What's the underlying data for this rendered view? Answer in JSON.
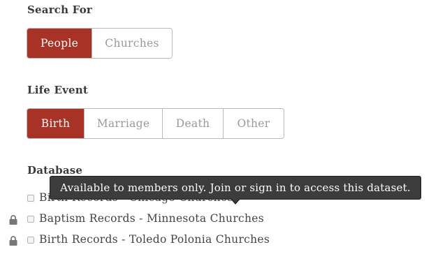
{
  "search_for": {
    "label": "Search For",
    "options": [
      "People",
      "Churches"
    ],
    "selected": "People"
  },
  "life_event": {
    "label": "Life Event",
    "options": [
      "Birth",
      "Marriage",
      "Death",
      "Other"
    ],
    "selected": "Birth"
  },
  "database": {
    "label": "Database",
    "items": [
      {
        "label": "Birth Records - Chicago Churches",
        "locked": false,
        "checked": false
      },
      {
        "label": "Baptism Records - Minnesota Churches",
        "locked": true,
        "checked": false
      },
      {
        "label": "Birth Records - Toledo Polonia Churches",
        "locked": true,
        "checked": false
      }
    ]
  },
  "tooltip": {
    "text": "Available to members only. Join or sign in to access this dataset."
  },
  "colors": {
    "accent": "#a93226",
    "tooltip_bg": "#3c3c3c",
    "lock_icon": "#777777"
  }
}
